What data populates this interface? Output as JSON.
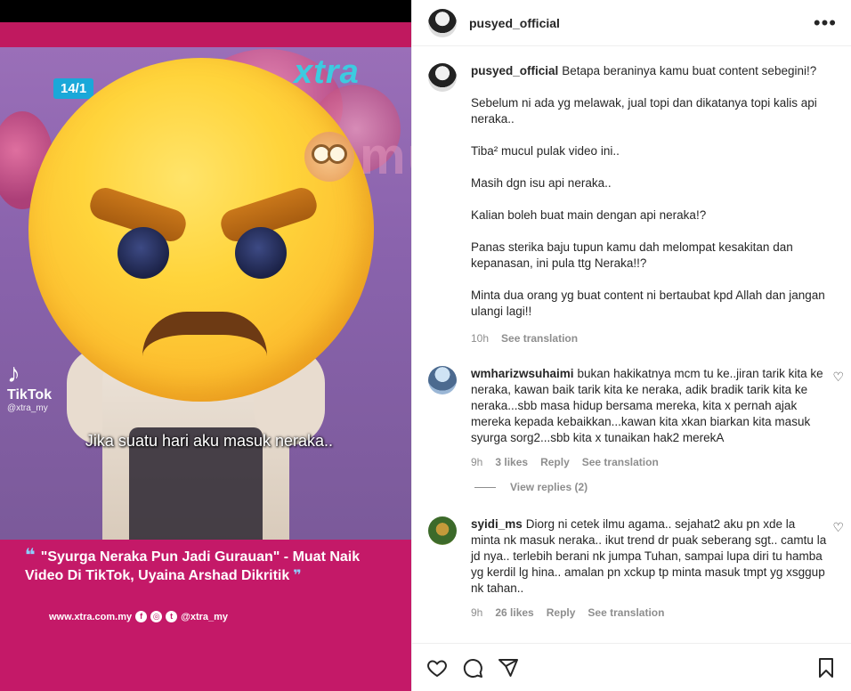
{
  "media": {
    "date_tag": "14/1",
    "brand_tag": "xtra",
    "tiktok_logo": "♪",
    "tiktok_name": "TikTok",
    "tiktok_handle": "@xtra_my",
    "subtitle": "Jika suatu hari aku masuk neraka..",
    "headline_quote_open": "❝",
    "headline": "\"Syurga Neraka Pun Jadi Gurauan\" - Muat Naik Video Di TikTok, Uyaina Arshad Dikritik",
    "headline_quote_close": "❞",
    "footer_site": "www.xtra.com.my",
    "footer_handle": "@xtra_my",
    "watermark": "murai"
  },
  "post": {
    "username": "pusyed_official",
    "more_icon": "more-horizontal-icon",
    "caption": {
      "username": "pusyed_official",
      "lines": [
        "Betapa beraninya kamu buat content sebegini!?",
        "Sebelum ni ada yg melawak, jual topi dan dikatanya topi kalis api neraka..",
        "Tiba² mucul pulak video ini..",
        "Masih dgn isu api neraka..",
        "Kalian boleh buat main dengan api neraka!?",
        "Panas sterika baju tupun kamu dah melompat kesakitan dan kepanasan, ini pula ttg Neraka!!?",
        "Minta dua orang yg buat content ni bertaubat kpd Allah dan jangan ulangi lagi!!"
      ],
      "time": "10h",
      "see_translation": "See translation"
    },
    "comments": [
      {
        "username": "wmharizwsuhaimi",
        "text": "bukan hakikatnya mcm tu ke..jiran tarik kita ke neraka, kawan baik tarik kita ke neraka, adik bradik tarik kita ke neraka...sbb masa hidup bersama mereka, kita x pernah ajak mereka kepada kebaikkan...kawan kita xkan biarkan kita masuk syurga sorg2...sbb kita x tunaikan hak2 merekA",
        "time": "9h",
        "likes": "3 likes",
        "reply": "Reply",
        "see_translation": "See translation",
        "view_replies": "View replies (2)"
      },
      {
        "username": "syidi_ms",
        "text": "Diorg ni cetek ilmu agama.. sejahat2 aku pn xde la minta nk masuk neraka.. ikut trend dr puak seberang sgt.. camtu la jd nya.. terlebih berani nk jumpa Tuhan, sampai lupa diri tu hamba yg kerdil lg hina.. amalan pn xckup tp minta masuk tmpt yg xsggup nk tahan..",
        "time": "9h",
        "likes": "26 likes",
        "reply": "Reply",
        "see_translation": "See translation"
      }
    ],
    "actions": [
      "heart-icon",
      "comment-icon",
      "share-icon",
      "bookmark-icon"
    ]
  },
  "colors": {
    "magenta_banner": "#c41968",
    "video_purple": "#8a63ad",
    "text_primary": "#262626",
    "text_secondary": "#8e8e8e"
  }
}
